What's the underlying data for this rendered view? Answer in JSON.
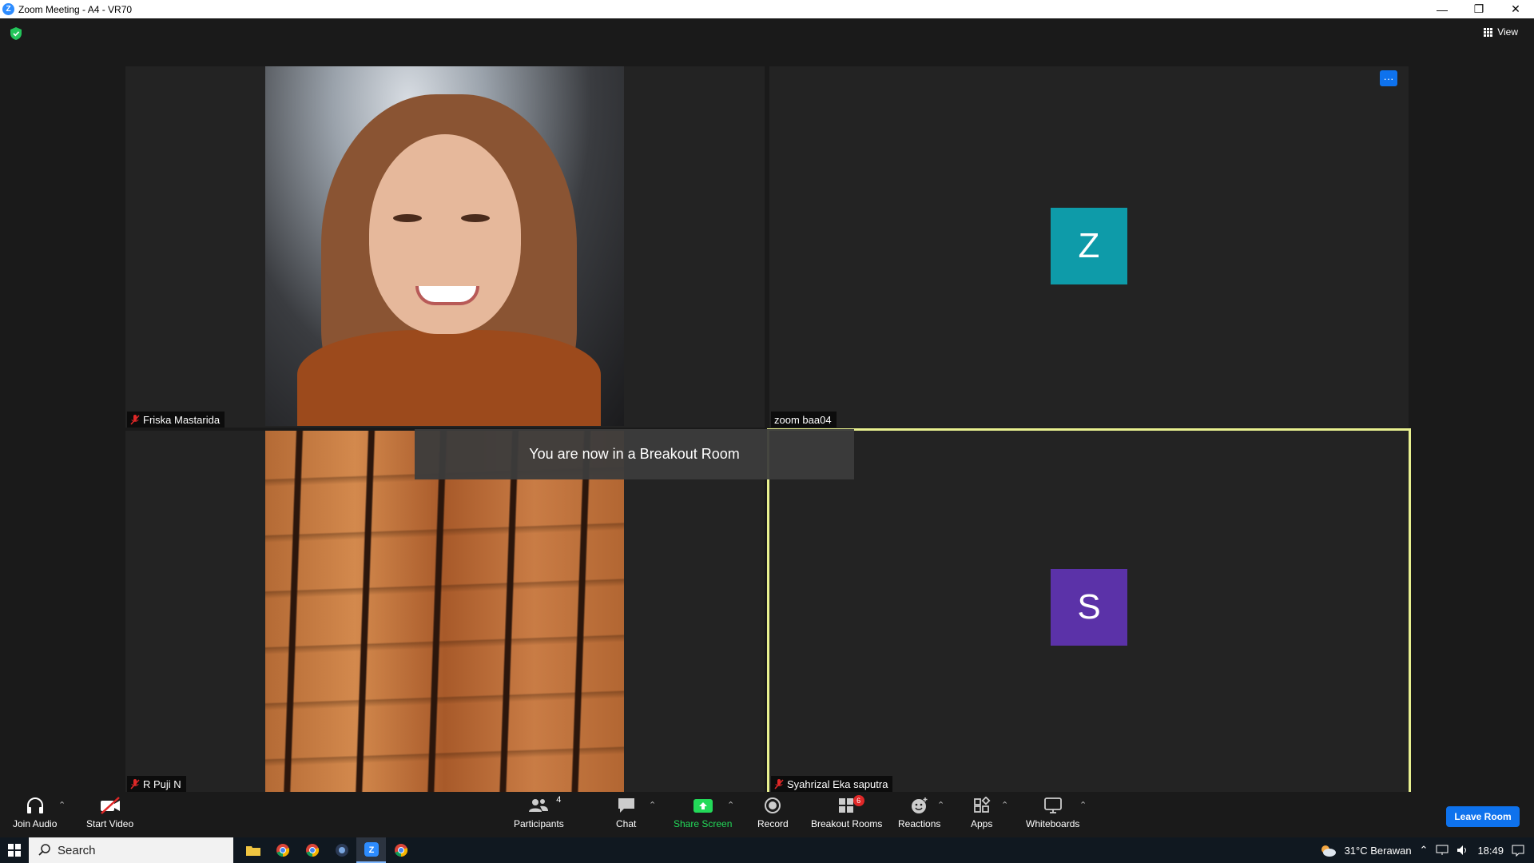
{
  "window": {
    "title": "Zoom Meeting - A4 - VR70",
    "controls": [
      "—",
      "❐",
      "✕"
    ]
  },
  "top": {
    "view_label": "View"
  },
  "participants": [
    {
      "name": "Friska Mastarida",
      "muted": true,
      "video": "camera"
    },
    {
      "name": "zoom baa04",
      "muted": false,
      "avatar_letter": "Z",
      "avatar_color": "#0e9ba9"
    },
    {
      "name": "R Puji N",
      "muted": true,
      "video": "camera"
    },
    {
      "name": "Syahrizal Eka saputra",
      "muted": true,
      "avatar_letter": "S",
      "avatar_color": "#5b32a8",
      "active_speaker": true
    }
  ],
  "tile_more_label": "···",
  "toast": "You are now in a Breakout Room",
  "toolbar": {
    "join_audio": "Join Audio",
    "start_video": "Start Video",
    "participants": "Participants",
    "participants_count": "4",
    "chat": "Chat",
    "share_screen": "Share Screen",
    "record": "Record",
    "breakout_rooms": "Breakout Rooms",
    "breakout_badge": "6",
    "reactions": "Reactions",
    "apps": "Apps",
    "whiteboards": "Whiteboards",
    "leave_room": "Leave Room"
  },
  "taskbar": {
    "search_label": "Search",
    "weather": "31°C  Berawan",
    "time": "18:49"
  },
  "colors": {
    "accent": "#0e72ed",
    "share_green": "#23d959",
    "active_border": "#e8f090"
  }
}
